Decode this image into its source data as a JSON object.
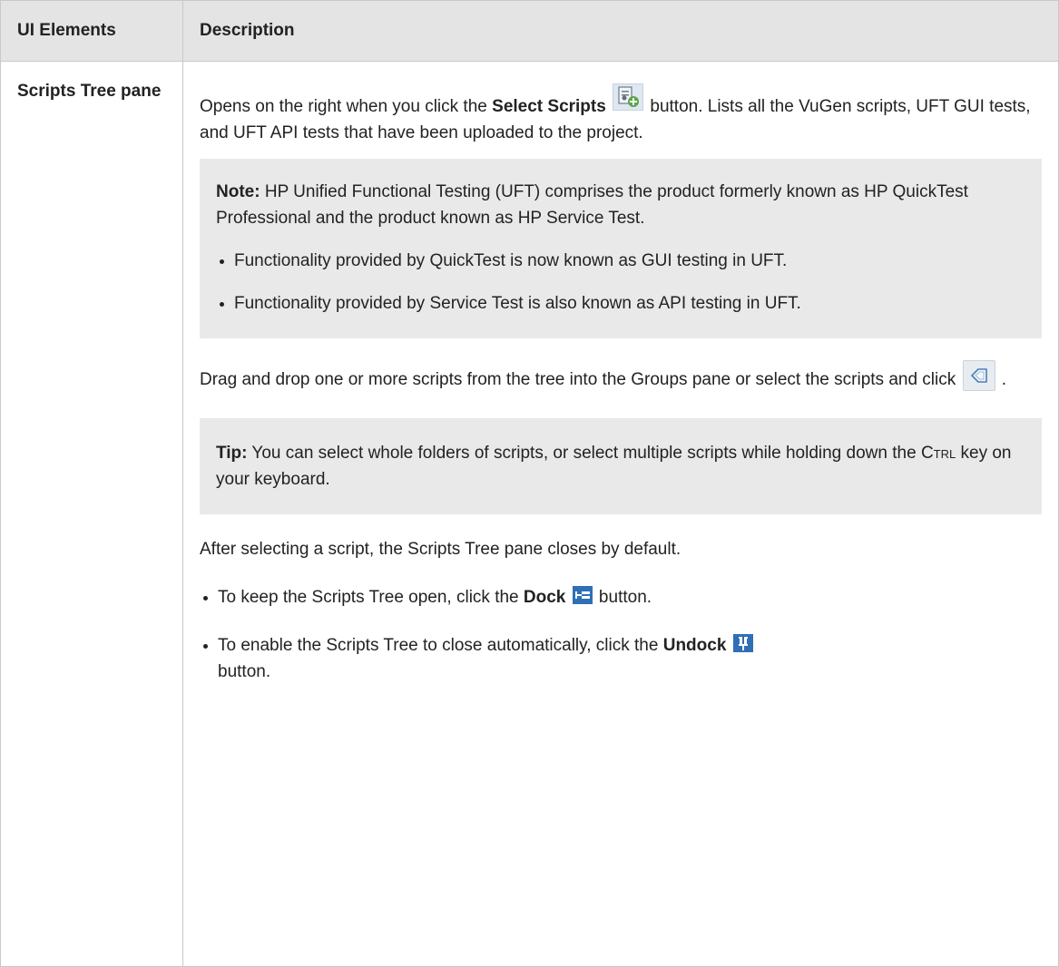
{
  "table": {
    "header": {
      "col1": "UI Elements",
      "col2": "Description"
    },
    "element": "Scripts Tree pane",
    "intro": {
      "before": "Opens on the right when you click the ",
      "button_name": "Select Scripts",
      "after": " button. Lists all the VuGen scripts, UFT GUI tests, and UFT API tests that have been uploaded to the project."
    },
    "note": {
      "label": "Note:",
      "text": " HP Unified Functional Testing (UFT) comprises the product formerly known as HP QuickTest Professional and the product known as HP Service Test.",
      "bullets": [
        "Functionality provided by QuickTest is now known as GUI testing in UFT.",
        "Functionality provided by Service Test is also known as API testing in UFT."
      ]
    },
    "drag": {
      "before": "Drag and drop one or more scripts from the tree into the Groups pane or select the scripts and click ",
      "after": "."
    },
    "tip": {
      "label": "Tip:",
      "before": " You can select whole folders of scripts, or select multiple scripts while holding down the ",
      "key": "Ctrl",
      "after": " key on your keyboard."
    },
    "after_select": "After selecting a script, the Scripts Tree pane closes by default.",
    "dock_items": [
      {
        "before": "To keep the Scripts Tree open, click the ",
        "bold": "Dock",
        "after": " button."
      },
      {
        "before": "To enable the Scripts Tree to close automatically, click the ",
        "bold": "Undock",
        "after": " button."
      }
    ]
  },
  "icons": {
    "select_scripts": "select-scripts-icon",
    "add_to_group": "add-arrow-icon",
    "dock": "dock-pin-icon",
    "undock": "undock-pin-icon"
  },
  "colors": {
    "header_bg": "#e4e4e4",
    "note_bg": "#e9e9e9",
    "border": "#c9c9c9"
  }
}
